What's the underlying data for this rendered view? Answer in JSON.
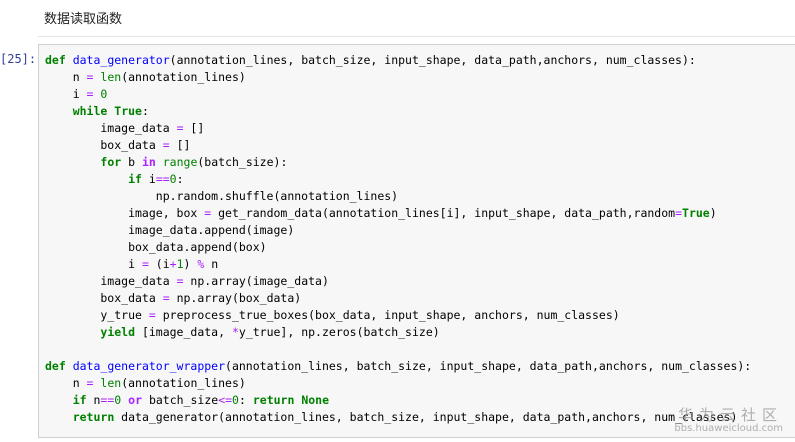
{
  "markdown_cell": {
    "text": "数据读取函数"
  },
  "code_cell": {
    "prompt": "[25]:",
    "lines": [
      [
        [
          "kw",
          "def "
        ],
        [
          "nf",
          "data_generator"
        ],
        [
          "p",
          "(annotation_lines, batch_size, input_shape, data_path,anchors, num_classes):"
        ]
      ],
      [
        [
          "tx",
          "    n "
        ],
        [
          "o",
          "="
        ],
        [
          "tx",
          " "
        ],
        [
          "nb",
          "len"
        ],
        [
          "p",
          "(annotation_lines)"
        ]
      ],
      [
        [
          "tx",
          "    i "
        ],
        [
          "o",
          "="
        ],
        [
          "tx",
          " "
        ],
        [
          "mi",
          "0"
        ]
      ],
      [
        [
          "tx",
          "    "
        ],
        [
          "kw",
          "while"
        ],
        [
          "tx",
          " "
        ],
        [
          "kw",
          "True"
        ],
        [
          "p",
          ":"
        ]
      ],
      [
        [
          "tx",
          "        image_data "
        ],
        [
          "o",
          "="
        ],
        [
          "tx",
          " []"
        ]
      ],
      [
        [
          "tx",
          "        box_data "
        ],
        [
          "o",
          "="
        ],
        [
          "tx",
          " []"
        ]
      ],
      [
        [
          "tx",
          "        "
        ],
        [
          "kw",
          "for"
        ],
        [
          "tx",
          " b "
        ],
        [
          "ow",
          "in"
        ],
        [
          "tx",
          " "
        ],
        [
          "nb",
          "range"
        ],
        [
          "p",
          "(batch_size):"
        ]
      ],
      [
        [
          "tx",
          "            "
        ],
        [
          "kw",
          "if"
        ],
        [
          "tx",
          " i"
        ],
        [
          "o",
          "=="
        ],
        [
          "mi",
          "0"
        ],
        [
          "p",
          ":"
        ]
      ],
      [
        [
          "tx",
          "                np.random.shuffle(annotation_lines)"
        ]
      ],
      [
        [
          "tx",
          "            image, box "
        ],
        [
          "o",
          "="
        ],
        [
          "tx",
          " get_random_data(annotation_lines[i], input_shape, data_path,random"
        ],
        [
          "o",
          "="
        ],
        [
          "kw",
          "True"
        ],
        [
          "p",
          ")"
        ]
      ],
      [
        [
          "tx",
          "            image_data.append(image)"
        ]
      ],
      [
        [
          "tx",
          "            box_data.append(box)"
        ]
      ],
      [
        [
          "tx",
          "            i "
        ],
        [
          "o",
          "="
        ],
        [
          "tx",
          " (i"
        ],
        [
          "o",
          "+"
        ],
        [
          "mi",
          "1"
        ],
        [
          "tx",
          ") "
        ],
        [
          "o",
          "%"
        ],
        [
          "tx",
          " n"
        ]
      ],
      [
        [
          "tx",
          "        image_data "
        ],
        [
          "o",
          "="
        ],
        [
          "tx",
          " np.array(image_data)"
        ]
      ],
      [
        [
          "tx",
          "        box_data "
        ],
        [
          "o",
          "="
        ],
        [
          "tx",
          " np.array(box_data)"
        ]
      ],
      [
        [
          "tx",
          "        y_true "
        ],
        [
          "o",
          "="
        ],
        [
          "tx",
          " preprocess_true_boxes(box_data, input_shape, anchors, num_classes)"
        ]
      ],
      [
        [
          "tx",
          "        "
        ],
        [
          "kw",
          "yield"
        ],
        [
          "tx",
          " [image_data, "
        ],
        [
          "o",
          "*"
        ],
        [
          "tx",
          "y_true], np.zeros(batch_size)"
        ]
      ],
      [
        [
          "tx",
          ""
        ]
      ],
      [
        [
          "kw",
          "def "
        ],
        [
          "nf",
          "data_generator_wrapper"
        ],
        [
          "p",
          "(annotation_lines, batch_size, input_shape, data_path,anchors, num_classes):"
        ]
      ],
      [
        [
          "tx",
          "    n "
        ],
        [
          "o",
          "="
        ],
        [
          "tx",
          " "
        ],
        [
          "nb",
          "len"
        ],
        [
          "p",
          "(annotation_lines)"
        ]
      ],
      [
        [
          "tx",
          "    "
        ],
        [
          "kw",
          "if"
        ],
        [
          "tx",
          " n"
        ],
        [
          "o",
          "=="
        ],
        [
          "mi",
          "0"
        ],
        [
          "tx",
          " "
        ],
        [
          "ow",
          "or"
        ],
        [
          "tx",
          " batch_size"
        ],
        [
          "o",
          "<="
        ],
        [
          "mi",
          "0"
        ],
        [
          "p",
          ": "
        ],
        [
          "kw",
          "return"
        ],
        [
          "tx",
          " "
        ],
        [
          "kw",
          "None"
        ]
      ],
      [
        [
          "tx",
          "    "
        ],
        [
          "kw",
          "return"
        ],
        [
          "tx",
          " data_generator(annotation_lines, batch_size, input_shape, data_path,anchors, num_classes)"
        ]
      ]
    ]
  },
  "watermark": {
    "text": "华为云社区",
    "url": "bbs.huaweicloud.com"
  }
}
